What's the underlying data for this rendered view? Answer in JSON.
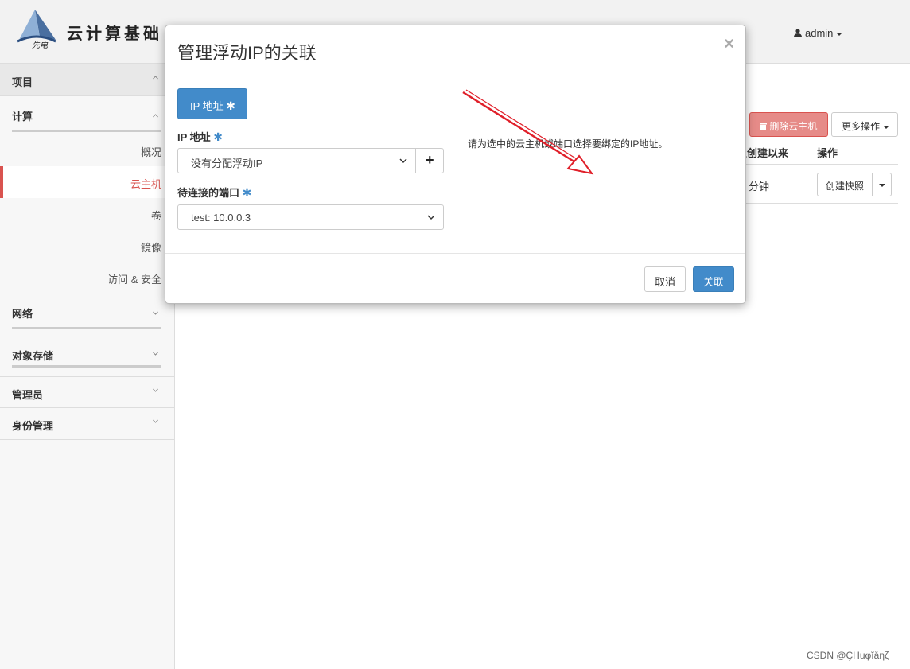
{
  "header": {
    "brand": "云计算基础",
    "logo_text": "先电",
    "user": "admin"
  },
  "sidebar": {
    "project": "项目",
    "compute": "计算",
    "items": [
      "概况",
      "云主机",
      "卷",
      "镜像",
      "访问 & 安全"
    ],
    "active_item": "云主机",
    "network": "网络",
    "object_storage": "对象存储",
    "admin": "管理员",
    "identity": "身份管理"
  },
  "content": {
    "delete_button": "删除云主机",
    "more_button": "更多操作",
    "col_since_created": "从创建以来",
    "col_actions": "操作",
    "row_time": "分钟",
    "snapshot_button": "创建快照"
  },
  "modal": {
    "title": "管理浮动IP的关联",
    "close": "×",
    "tab_label": "IP 地址",
    "ip_label": "IP 地址",
    "ip_select_value": "没有分配浮动IP",
    "add_button": "+",
    "port_label": "待连接的端口",
    "port_select_value": "test: 10.0.0.3",
    "help_text": "请为选中的云主机或端口选择要绑定的IP地址。",
    "cancel": "取消",
    "associate": "关联",
    "required_mark": "✱"
  },
  "watermark": "CSDN @ÇHuφĭåηζ",
  "colors": {
    "primary": "#428bca",
    "danger": "#d9534f",
    "annotation_arrow": "#e0202a"
  }
}
